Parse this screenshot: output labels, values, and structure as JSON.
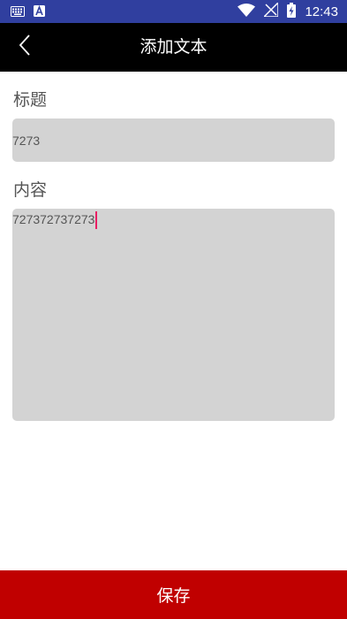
{
  "status_bar": {
    "time": "12:43",
    "icons": [
      "keyboard-icon",
      "a-notification-icon",
      "wifi-icon",
      "no-signal-icon",
      "battery-charging-icon"
    ]
  },
  "app_bar": {
    "title": "添加文本",
    "back_icon": "chevron-left-icon"
  },
  "form": {
    "title_label": "标题",
    "title_value": "7273",
    "content_label": "内容",
    "content_value": "727372737273"
  },
  "footer": {
    "save_label": "保存"
  },
  "colors": {
    "status_bar": "#303f9f",
    "app_bar": "#000000",
    "field_bg": "#d3d3d3",
    "save_bar": "#c00000",
    "caret": "#e91e63"
  }
}
